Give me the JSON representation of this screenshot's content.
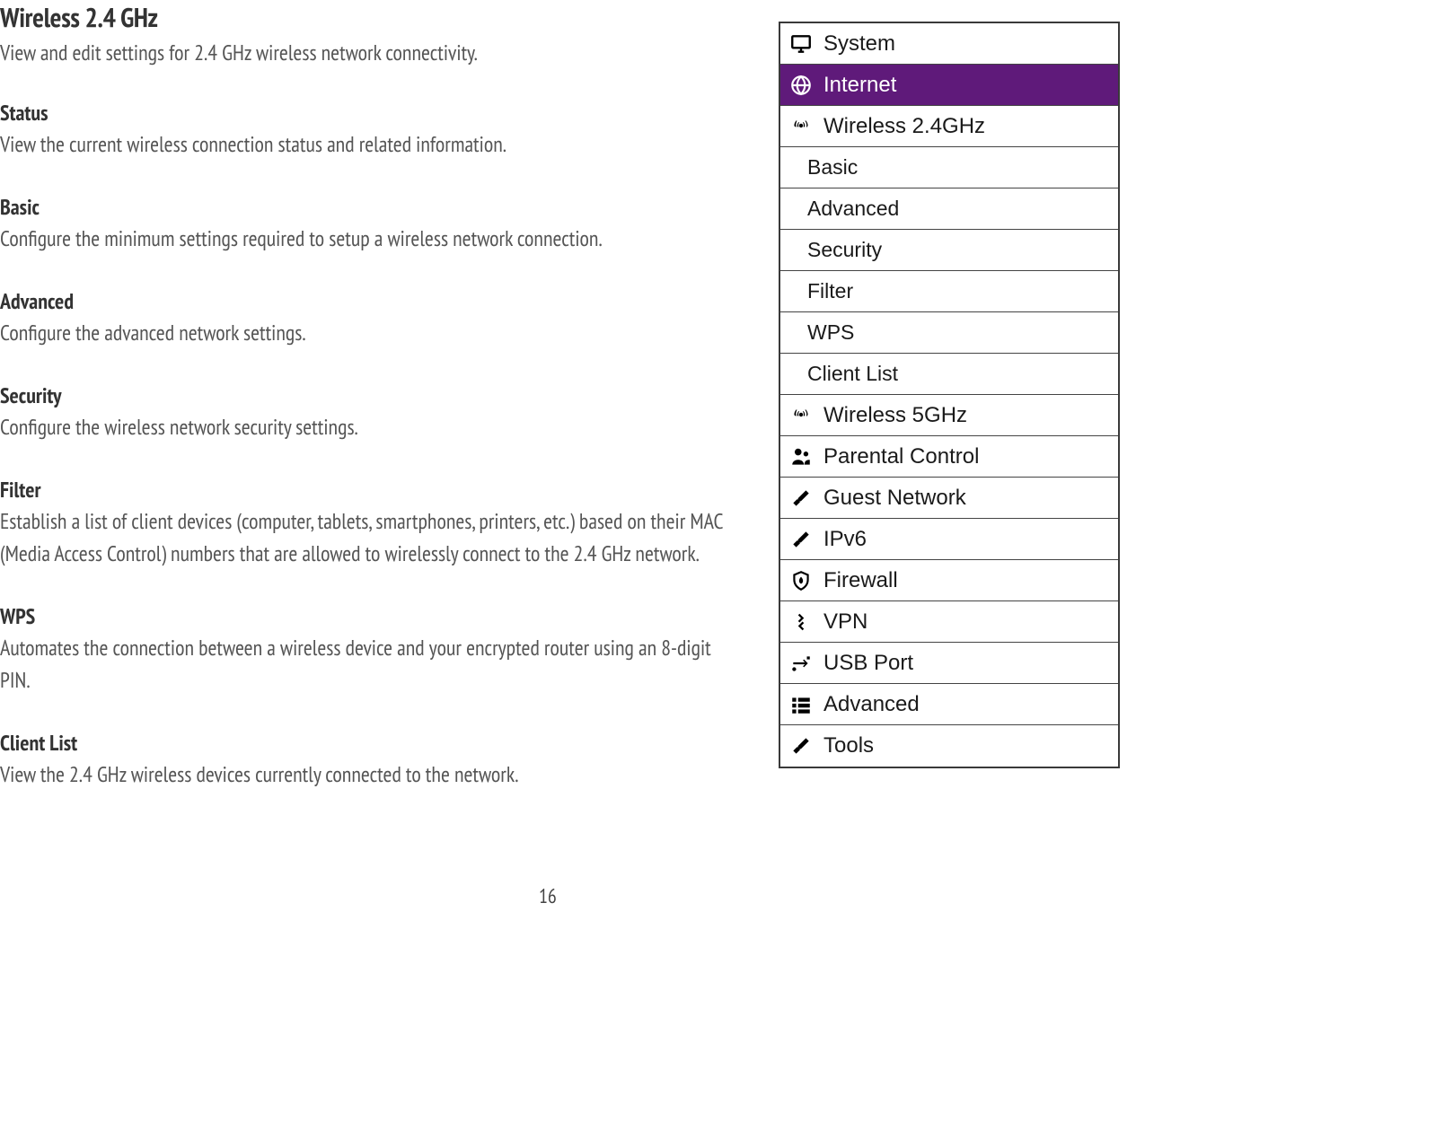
{
  "page": {
    "title": "Wireless 2.4 GHz",
    "subtitle": "View and edit settings for 2.4 GHz wireless network connectivity.",
    "number": "16"
  },
  "sections": [
    {
      "heading": "Status",
      "desc": "View the current wireless connection status and related information."
    },
    {
      "heading": "Basic",
      "desc": "Configure the minimum settings required to setup a wireless network connection."
    },
    {
      "heading": "Advanced",
      "desc": "Configure the advanced network settings."
    },
    {
      "heading": "Security",
      "desc": "Configure the wireless network security settings."
    },
    {
      "heading": "Filter",
      "desc": "Establish a list of client devices (computer, tablets, smartphones, printers, etc.) based on their MAC (Media Access Control) numbers that are allowed to wirelessly connect to the 2.4 GHz network."
    },
    {
      "heading": "WPS",
      "desc": "Automates the connection between a wireless device and your encrypted router using an 8-digit PIN."
    },
    {
      "heading": "Client List",
      "desc": "View the 2.4 GHz wireless devices currently connected to the network."
    }
  ],
  "sidebar": {
    "items": [
      {
        "label": "System",
        "icon": "monitor-icon",
        "selected": false
      },
      {
        "label": "Internet",
        "icon": "globe-icon",
        "selected": true
      },
      {
        "label": "Wireless 2.4GHz",
        "icon": "wifi-icon",
        "selected": false
      },
      {
        "label": "Wireless 5GHz",
        "icon": "wifi-icon",
        "selected": false
      },
      {
        "label": "Parental Control",
        "icon": "people-icon",
        "selected": false
      },
      {
        "label": "Guest Network",
        "icon": "tools-icon",
        "selected": false
      },
      {
        "label": "IPv6",
        "icon": "tools-icon",
        "selected": false
      },
      {
        "label": "Firewall",
        "icon": "firewall-icon",
        "selected": false
      },
      {
        "label": "VPN",
        "icon": "vpn-icon",
        "selected": false
      },
      {
        "label": "USB Port",
        "icon": "usb-icon",
        "selected": false
      },
      {
        "label": "Advanced",
        "icon": "list-icon",
        "selected": false
      },
      {
        "label": "Tools",
        "icon": "tools-icon",
        "selected": false
      }
    ],
    "subitems": [
      {
        "label": "Basic"
      },
      {
        "label": "Advanced"
      },
      {
        "label": "Security"
      },
      {
        "label": "Filter"
      },
      {
        "label": "WPS"
      },
      {
        "label": "Client List"
      }
    ]
  }
}
